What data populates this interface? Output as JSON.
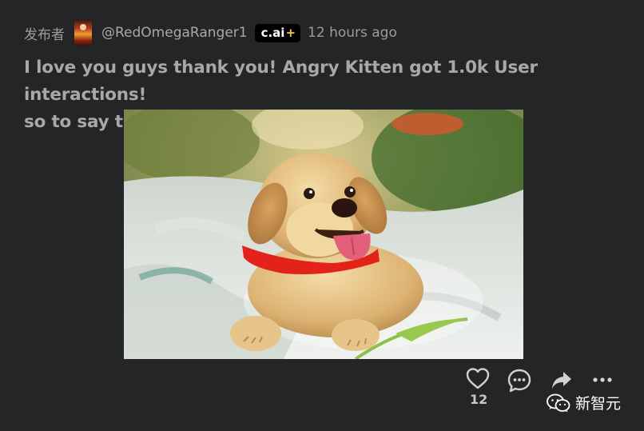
{
  "post": {
    "posted_by_label": "发布者",
    "username": "@RedOmegaRanger1",
    "badge": {
      "text": "c.ai",
      "plus": "+"
    },
    "time": "12 hours ago",
    "title_line1": "I love you guys thank you! Angry Kitten got 1.0k User interactions!",
    "title_line2": "so to say thanks...",
    "image_subject": "golden-retriever-puppy-photo",
    "actions": {
      "like_icon": "heart-icon",
      "like_count": "12",
      "comment_icon": "comment-icon",
      "share_icon": "share-icon",
      "more_icon": "more-icon"
    }
  },
  "watermark": {
    "icon": "wechat-icon",
    "text": "新智元"
  }
}
